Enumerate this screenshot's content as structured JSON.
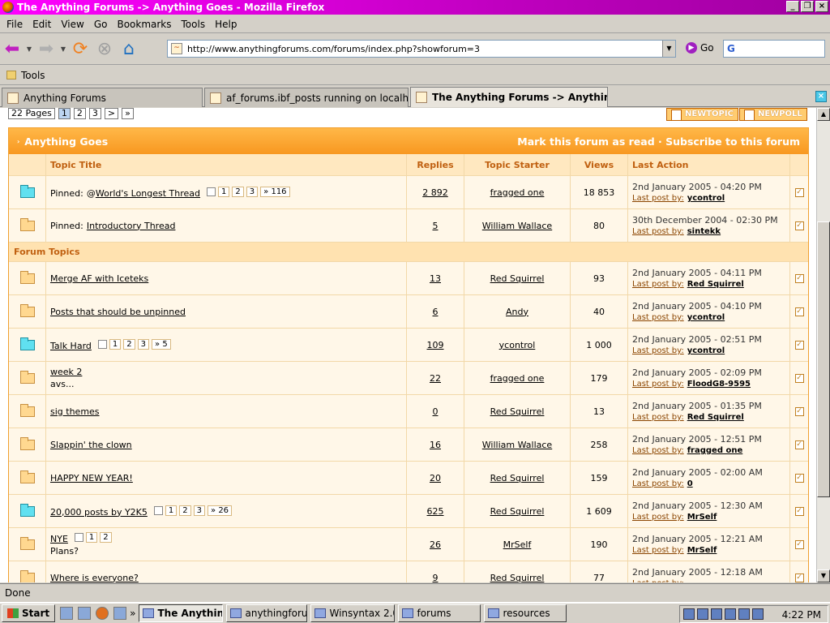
{
  "window": {
    "title": "The Anything Forums -> Anything Goes - Mozilla Firefox"
  },
  "menu": [
    "File",
    "Edit",
    "View",
    "Go",
    "Bookmarks",
    "Tools",
    "Help"
  ],
  "nav": {
    "url": "http://www.anythingforums.com/forums/index.php?showforum=3",
    "go_label": "Go",
    "search_logo": "G"
  },
  "bookmarks": {
    "tools_label": "Tools"
  },
  "tabs": [
    "Anything Forums",
    "af_forums.ibf_posts running on localhost - ...",
    "The Anything Forums -> Anything G..."
  ],
  "pagination": {
    "label": "22 Pages",
    "pages": [
      "1",
      "2",
      "3",
      ">",
      "»"
    ],
    "current": "1"
  },
  "buttons": {
    "new_topic": "NEWTOPIC",
    "new_poll": "NEWPOLL"
  },
  "forum": {
    "name": "Anything Goes",
    "actions": "Mark this forum as read · Subscribe to this forum",
    "columns": {
      "title": "Topic Title",
      "replies": "Replies",
      "starter": "Topic Starter",
      "views": "Views",
      "last_action": "Last Action"
    },
    "section_label": "Forum Topics",
    "last_post_label": "Last post by:",
    "pinned_prefix": "Pinned:"
  },
  "pinned": [
    {
      "title": "World's Longest Thread",
      "poll_mark": "@",
      "pages": [
        "1",
        "2",
        "3",
        "» 116"
      ],
      "replies": "2 892",
      "starter": "fragged one",
      "views": "18 853",
      "date": "2nd January 2005 - 04:20 PM",
      "last_by": "ycontrol",
      "hot": true
    },
    {
      "title": "Introductory Thread",
      "pages": [],
      "replies": "5",
      "starter": "William Wallace",
      "views": "80",
      "date": "30th December 2004 - 02:30 PM",
      "last_by": "sintekk",
      "hot": false
    }
  ],
  "topics": [
    {
      "title": "Merge AF with Iceteks",
      "desc": "",
      "pages": [],
      "replies": "13",
      "starter": "Red Squirrel",
      "views": "93",
      "date": "2nd January 2005 - 04:11 PM",
      "last_by": "Red Squirrel",
      "hot": false
    },
    {
      "title": "Posts that should be unpinned",
      "desc": "",
      "pages": [],
      "replies": "6",
      "starter": "Andy",
      "views": "40",
      "date": "2nd January 2005 - 04:10 PM",
      "last_by": "ycontrol",
      "hot": false
    },
    {
      "title": "Talk Hard",
      "desc": "",
      "pages": [
        "1",
        "2",
        "3",
        "» 5"
      ],
      "replies": "109",
      "starter": "ycontrol",
      "views": "1 000",
      "date": "2nd January 2005 - 02:51 PM",
      "last_by": "ycontrol",
      "hot": true
    },
    {
      "title": "week 2",
      "desc": "avs...",
      "pages": [],
      "replies": "22",
      "starter": "fragged one",
      "views": "179",
      "date": "2nd January 2005 - 02:09 PM",
      "last_by": "FloodG8-9595",
      "hot": false
    },
    {
      "title": "sig themes",
      "desc": "",
      "pages": [],
      "replies": "0",
      "starter": "Red Squirrel",
      "views": "13",
      "date": "2nd January 2005 - 01:35 PM",
      "last_by": "Red Squirrel",
      "hot": false
    },
    {
      "title": "Slappin' the clown",
      "desc": "",
      "pages": [],
      "replies": "16",
      "starter": "William Wallace",
      "views": "258",
      "date": "2nd January 2005 - 12:51 PM",
      "last_by": "fragged one",
      "hot": false
    },
    {
      "title": "HAPPY NEW YEAR!",
      "desc": "",
      "pages": [],
      "replies": "20",
      "starter": "Red Squirrel",
      "views": "159",
      "date": "2nd January 2005 - 02:00 AM",
      "last_by": "0",
      "hot": false
    },
    {
      "title": "20,000 posts by Y2K5",
      "desc": "",
      "pages": [
        "1",
        "2",
        "3",
        "» 26"
      ],
      "replies": "625",
      "starter": "Red Squirrel",
      "views": "1 609",
      "date": "2nd January 2005 - 12:30 AM",
      "last_by": "MrSelf",
      "hot": true
    },
    {
      "title": "NYE",
      "desc": "Plans?",
      "pages": [
        "1",
        "2"
      ],
      "replies": "26",
      "starter": "MrSelf",
      "views": "190",
      "date": "2nd January 2005 - 12:21 AM",
      "last_by": "MrSelf",
      "hot": false
    },
    {
      "title": "Where is everyone?",
      "desc": "",
      "pages": [],
      "replies": "9",
      "starter": "Red Squirrel",
      "views": "77",
      "date": "2nd January 2005 - 12:18 AM",
      "last_by": "",
      "hot": false
    }
  ],
  "status": "Done",
  "taskbar": {
    "start": "Start",
    "items": [
      "The Anythin...",
      "anythingforums",
      "Winsyntax 2.0",
      "forums",
      "resources"
    ],
    "clock": "4:22 PM"
  }
}
